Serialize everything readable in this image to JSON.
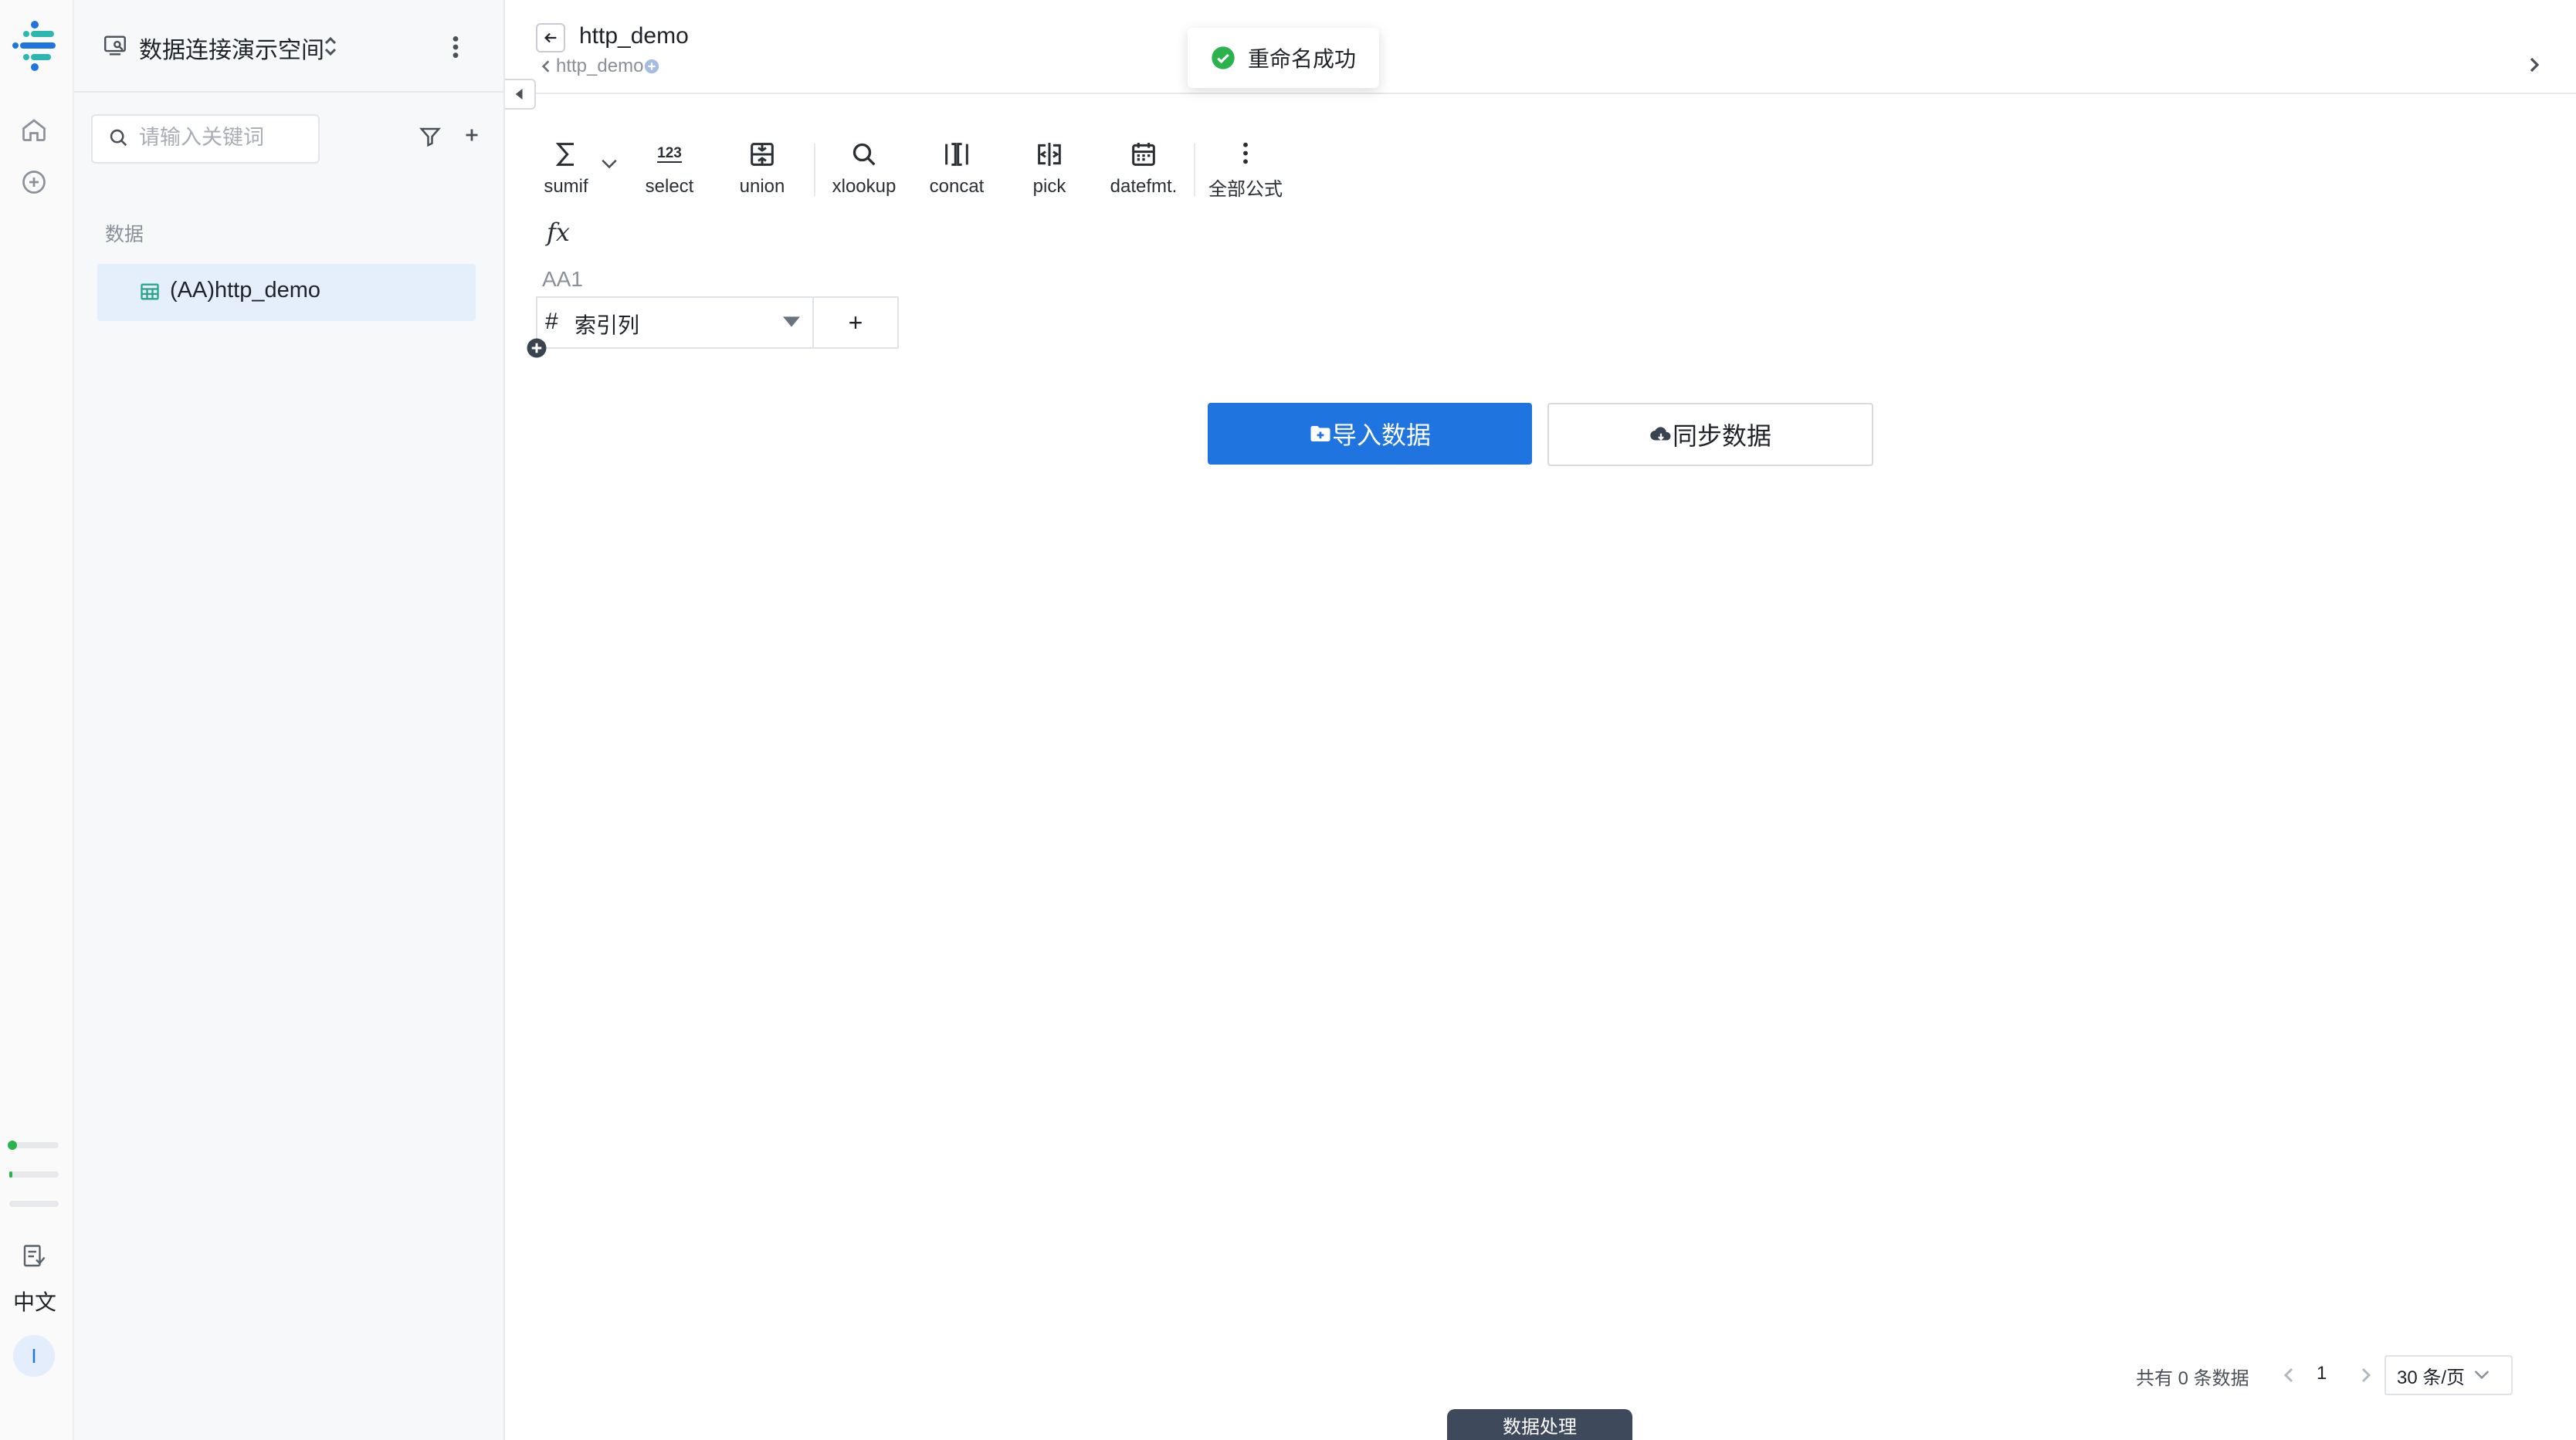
{
  "workspace": {
    "name": "数据连接演示空间"
  },
  "sidebar": {
    "search_placeholder": "请输入关键词",
    "section_label": "数据",
    "items": [
      {
        "label": "(AA)http_demo"
      }
    ]
  },
  "rail": {
    "language": "中文",
    "avatar_letter": "I"
  },
  "header": {
    "title": "http_demo",
    "breadcrumb": "http_demo"
  },
  "toast": {
    "message": "重命名成功"
  },
  "toolbar": {
    "tools": [
      {
        "label": "sumif",
        "icon": "sigma-icon"
      },
      {
        "label": "select",
        "icon": "number-123-icon"
      },
      {
        "label": "union",
        "icon": "union-icon"
      },
      {
        "label": "xlookup",
        "icon": "search-icon"
      },
      {
        "label": "concat",
        "icon": "concat-icon"
      },
      {
        "label": "pick",
        "icon": "pick-icon"
      },
      {
        "label": "datefmt.",
        "icon": "calendar-icon"
      },
      {
        "label": "全部公式",
        "icon": "more-vertical-icon"
      }
    ],
    "fx_label": "fx"
  },
  "grid": {
    "cell_ref": "AA1",
    "column_header": "索引列",
    "add_column_label": "+"
  },
  "actions": {
    "import_label": "导入数据",
    "sync_label": "同步数据"
  },
  "pagination": {
    "total_text": "共有 0 条数据",
    "current_page": "1",
    "page_size": "30 条/页"
  },
  "bottom_tab": {
    "label": "数据处理"
  },
  "colors": {
    "primary": "#1f74e0",
    "success": "#2bb24c",
    "sidebar_bg": "#f7f8fa",
    "selected_bg": "#e5eefb"
  }
}
